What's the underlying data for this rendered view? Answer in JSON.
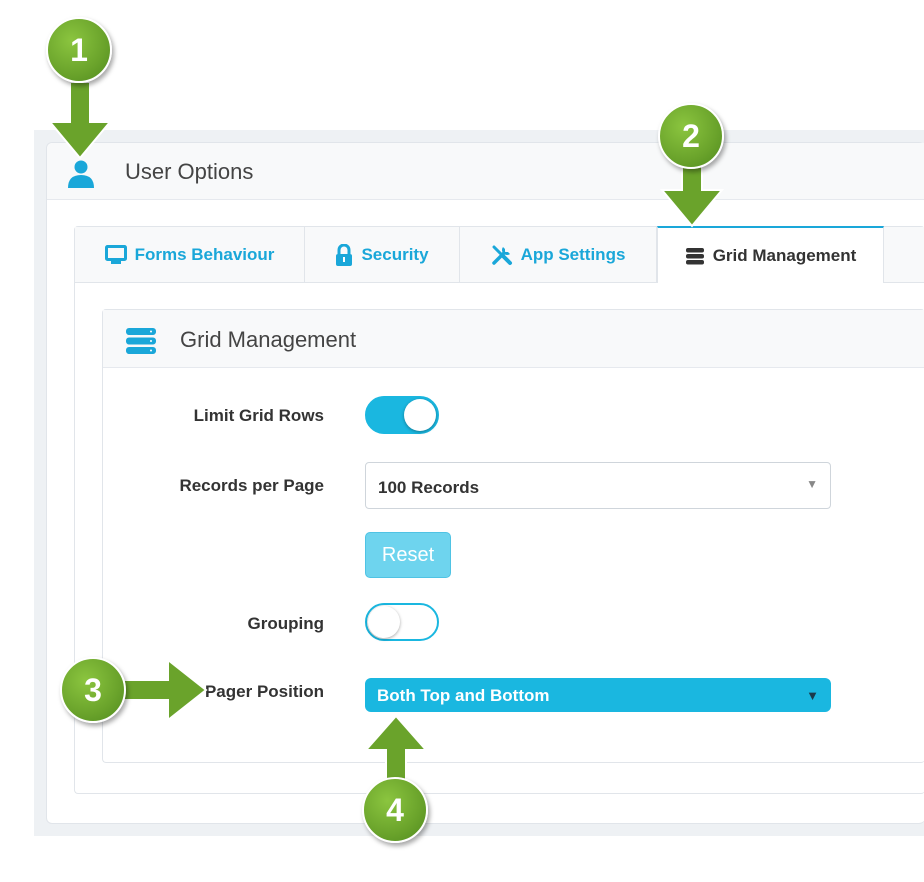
{
  "panel": {
    "title": "User Options",
    "icon": "user-icon"
  },
  "tabs": [
    {
      "label": "Forms Behaviour",
      "icon": "monitor-icon",
      "active": false
    },
    {
      "label": "Security",
      "icon": "lock-icon",
      "active": false
    },
    {
      "label": "App Settings",
      "icon": "tools-icon",
      "active": false
    },
    {
      "label": "Grid Management",
      "icon": "database-icon",
      "active": true
    }
  ],
  "grid_panel": {
    "title": "Grid Management",
    "icon": "database-icon",
    "limit_grid_rows_label": "Limit Grid Rows",
    "limit_grid_rows_on": true,
    "records_per_page_label": "Records per Page",
    "records_per_page_value": "100 Records",
    "reset_label": "Reset",
    "grouping_label": "Grouping",
    "grouping_on": false,
    "pager_position_label": "Pager Position",
    "pager_position_value": "Both Top and Bottom"
  },
  "callouts": [
    "1",
    "2",
    "3",
    "4"
  ],
  "colors": {
    "accent": "#1ab7e0",
    "callout_green": "#6aa32b"
  }
}
